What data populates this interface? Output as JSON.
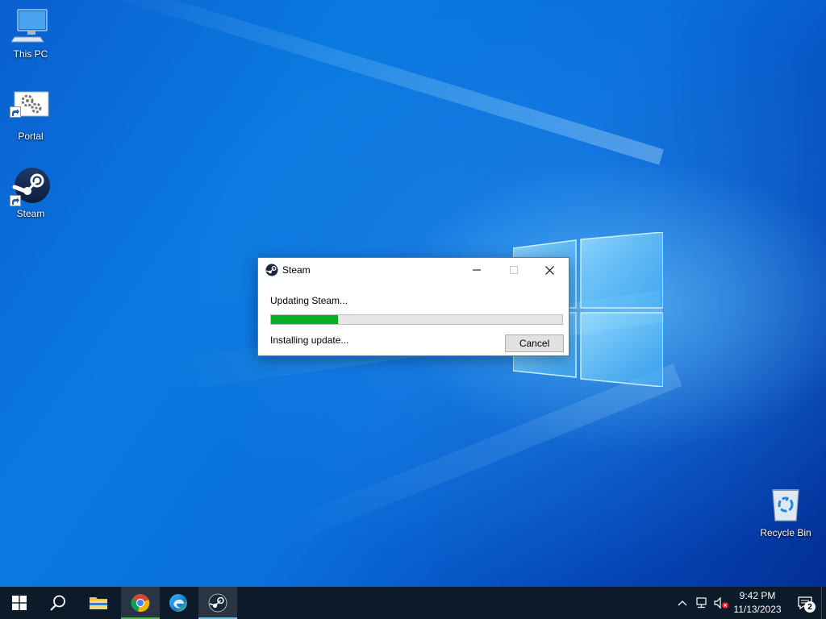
{
  "desktop": {
    "icons": [
      {
        "label": "This PC",
        "icon": "computer-icon"
      },
      {
        "label": "Portal",
        "icon": "settings-gears-icon"
      },
      {
        "label": "Steam",
        "icon": "steam-icon"
      },
      {
        "label": "Recycle Bin",
        "icon": "recycle-bin-icon"
      }
    ]
  },
  "dialog": {
    "title": "Steam",
    "status": "Updating Steam...",
    "progress": 0.23,
    "substatus": "Installing update...",
    "cancel_label": "Cancel",
    "accent_color": "#06b025"
  },
  "taskbar": {
    "apps": [
      {
        "name": "start",
        "icon": "windows-icon"
      },
      {
        "name": "search",
        "icon": "search-icon"
      },
      {
        "name": "file-explorer",
        "icon": "folder-icon"
      },
      {
        "name": "chrome",
        "icon": "chrome-icon"
      },
      {
        "name": "edge",
        "icon": "edge-icon"
      },
      {
        "name": "steam",
        "icon": "steam-icon"
      }
    ],
    "tray": {
      "time": "9:42 PM",
      "date": "11/13/2023",
      "notification_count": "2"
    }
  }
}
